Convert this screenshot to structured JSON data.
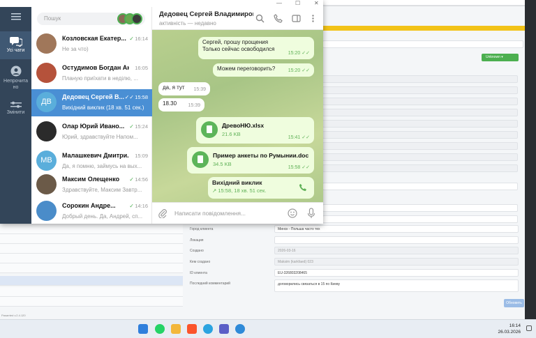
{
  "background": {
    "unknown_button": "Unknown",
    "update_button": "Обновить",
    "version": "Pasarrted v.2.4.120",
    "fields": [
      {
        "label": "Город клиента",
        "value": "Минск - Польша часто тех"
      },
      {
        "label": "Локация",
        "value": ""
      },
      {
        "label": "Создано",
        "value": "2026-03-16"
      },
      {
        "label": "Кем создано",
        "value": "Maksim (karkfaed) 023"
      },
      {
        "label": "ID клиента",
        "value": "EU-326803208465"
      },
      {
        "label": "Последний комментарий",
        "value": "договорились связаться в 15 по Киеву"
      }
    ]
  },
  "telegram": {
    "window_controls": {
      "minimize": "—",
      "maximize": "☐",
      "close": "✕"
    },
    "rail": [
      {
        "label": "Усі чати",
        "icon": "chats-icon"
      },
      {
        "label": "Непрочитано",
        "icon": "user-icon"
      },
      {
        "label": "Змінити",
        "icon": "edit-folders-icon"
      }
    ],
    "search_placeholder": "Пошук",
    "chats": [
      {
        "name": "Козловская Екатер...",
        "time": "16:14",
        "preview": "Не за что)",
        "avatar": "",
        "color": "#a0775a",
        "check": "✓"
      },
      {
        "name": "Остудимов Богдан Ан...",
        "time": "16:05",
        "preview": "Планую приїхати в неділю, ...",
        "avatar": "",
        "color": "#b5523b",
        "check": ""
      },
      {
        "name": "Дедовец Сергей В...",
        "time": "15:58",
        "preview": "Вихідний виклик (18 хв. 51 сек.)",
        "avatar": "ДВ",
        "color": "#5aaedb",
        "check": "✓✓"
      },
      {
        "name": "Олар Юрий Ивано...",
        "time": "15:24",
        "preview": "Юрий, здравствуйте Напом...",
        "avatar": "",
        "color": "#2b2b2b",
        "check": "✓"
      },
      {
        "name": "Малашкевич Дмитри...",
        "time": "15:09",
        "preview": "Да, я помню, займусь на вых...",
        "avatar": "МВ",
        "color": "#5aaedb",
        "check": ""
      },
      {
        "name": "Максим Олещенко",
        "time": "14:56",
        "preview": "Здравствуйте, Максим Завтр...",
        "avatar": "",
        "color": "#6b5a48",
        "check": "✓"
      },
      {
        "name": "Сорокин Андре...",
        "time": "14:16",
        "preview": "Добрый день. Да, Андрей, сп...",
        "avatar": "",
        "color": "#4a8cc9",
        "check": "✓"
      }
    ],
    "conversation": {
      "title": "Дедовец Сергей Владимиров...",
      "status": "активність — недавно",
      "messages": [
        {
          "type": "out",
          "text1": "Сергей, прошу прощения",
          "text2": "Только сейчас освободился",
          "time": "15:20"
        },
        {
          "type": "out",
          "text1": "Можем переговорить?",
          "time": "15:20"
        },
        {
          "type": "in",
          "text1": "да, я тут",
          "time": "15:39"
        },
        {
          "type": "in",
          "text1": "18.30",
          "time": "15:39"
        },
        {
          "type": "doc",
          "name": "ДревоНЮ.xlsx",
          "size": "21.6 KB",
          "time": "15:41"
        },
        {
          "type": "doc",
          "name": "Пример анкеты по Румынии.doc",
          "size": "34.5 KB",
          "time": "15:58"
        },
        {
          "type": "call",
          "title": "Вихідний виклик",
          "detail": "↗ 15:58, 18 хв. 51 сек."
        }
      ],
      "composer_placeholder": "Написати повідомлення..."
    }
  },
  "taskbar": {
    "time": "16:14",
    "date": "26.03.2026"
  }
}
